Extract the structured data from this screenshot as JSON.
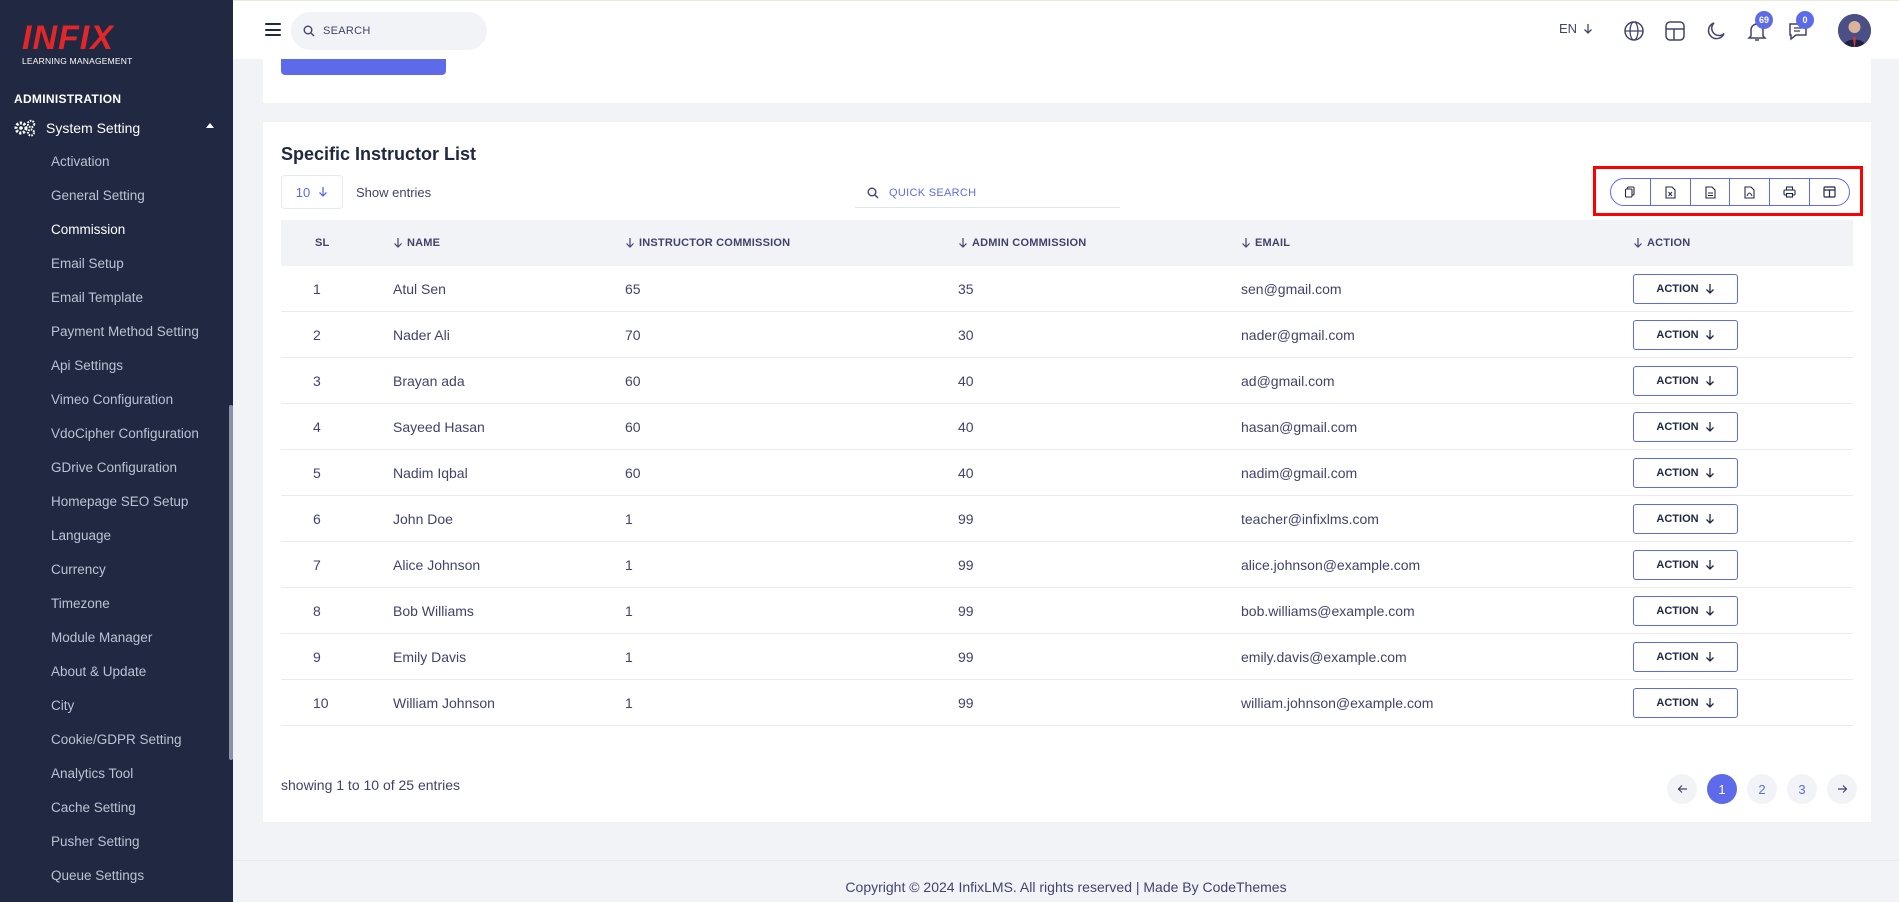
{
  "brand": {
    "logo_word": "INFIX",
    "logo_sub": "LEARNING MANAGEMENT"
  },
  "sidebar": {
    "section": "ADMINISTRATION",
    "parent": "System Setting",
    "items": [
      {
        "label": "Activation"
      },
      {
        "label": "General Setting"
      },
      {
        "label": "Commission",
        "active": true
      },
      {
        "label": "Email Setup"
      },
      {
        "label": "Email Template"
      },
      {
        "label": "Payment Method Setting"
      },
      {
        "label": "Api Settings"
      },
      {
        "label": "Vimeo Configuration"
      },
      {
        "label": "VdoCipher Configuration"
      },
      {
        "label": "GDrive Configuration"
      },
      {
        "label": "Homepage SEO Setup"
      },
      {
        "label": "Language"
      },
      {
        "label": "Currency"
      },
      {
        "label": "Timezone"
      },
      {
        "label": "Module Manager"
      },
      {
        "label": "About & Update"
      },
      {
        "label": "City"
      },
      {
        "label": "Cookie/GDPR Setting"
      },
      {
        "label": "Analytics Tool"
      },
      {
        "label": "Cache Setting"
      },
      {
        "label": "Pusher Setting"
      },
      {
        "label": "Queue Settings"
      }
    ]
  },
  "topbar": {
    "search_placeholder": "SEARCH",
    "lang": "EN",
    "notif_count": "69",
    "msg_count": "0"
  },
  "list": {
    "title": "Specific Instructor List",
    "entries_value": "10",
    "entries_label": "Show entries",
    "quick_search": "QUICK SEARCH",
    "headers": {
      "sl": "SL",
      "name": "NAME",
      "inst": "INSTRUCTOR COMMISSION",
      "admin": "ADMIN COMMISSION",
      "email": "EMAIL",
      "action": "ACTION"
    },
    "rows": [
      {
        "sl": "1",
        "name": "Atul Sen",
        "inst": "65",
        "admin": "35",
        "email": "sen@gmail.com",
        "action": "ACTION"
      },
      {
        "sl": "2",
        "name": "Nader Ali",
        "inst": "70",
        "admin": "30",
        "email": "nader@gmail.com",
        "action": "ACTION"
      },
      {
        "sl": "3",
        "name": "Brayan ada",
        "inst": "60",
        "admin": "40",
        "email": "ad@gmail.com",
        "action": "ACTION"
      },
      {
        "sl": "4",
        "name": "Sayeed Hasan",
        "inst": "60",
        "admin": "40",
        "email": "hasan@gmail.com",
        "action": "ACTION"
      },
      {
        "sl": "5",
        "name": "Nadim Iqbal",
        "inst": "60",
        "admin": "40",
        "email": "nadim@gmail.com",
        "action": "ACTION"
      },
      {
        "sl": "6",
        "name": "John Doe",
        "inst": "1",
        "admin": "99",
        "email": "teacher@infixlms.com",
        "action": "ACTION"
      },
      {
        "sl": "7",
        "name": "Alice Johnson",
        "inst": "1",
        "admin": "99",
        "email": "alice.johnson@example.com",
        "action": "ACTION"
      },
      {
        "sl": "8",
        "name": "Bob Williams",
        "inst": "1",
        "admin": "99",
        "email": "bob.williams@example.com",
        "action": "ACTION"
      },
      {
        "sl": "9",
        "name": "Emily Davis",
        "inst": "1",
        "admin": "99",
        "email": "emily.davis@example.com",
        "action": "ACTION"
      },
      {
        "sl": "10",
        "name": "William Johnson",
        "inst": "1",
        "admin": "99",
        "email": "william.johnson@example.com",
        "action": "ACTION"
      }
    ],
    "showing": "showing 1 to 10 of 25 entries",
    "pages": [
      "1",
      "2",
      "3"
    ],
    "current_page": "1"
  },
  "footer": {
    "text": "Copyright © 2024 InfixLMS. All rights reserved | Made By CodeThemes"
  },
  "colors": {
    "accent": "#5d6bea",
    "sidebar": "#202941",
    "highlight": "#ff0000"
  }
}
